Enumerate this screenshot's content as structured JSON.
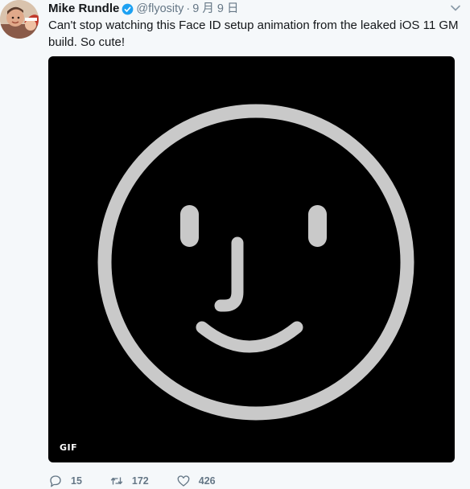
{
  "tweet": {
    "author_name": "Mike Rundle",
    "handle": "@flyosity",
    "separator": "·",
    "timestamp": "9 月 9 日",
    "text": "Can't stop watching this Face ID setup animation from the leaked iOS 11 GM build. So cute!",
    "media": {
      "badge": "GIF",
      "background": "#000000",
      "face_color": "#c9c9c9"
    },
    "actions": {
      "reply_count": "15",
      "retweet_count": "172",
      "like_count": "426"
    },
    "icons": {
      "verified": "verified-badge-icon",
      "caret": "chevron-down-icon",
      "reply": "reply-icon",
      "retweet": "retweet-icon",
      "like": "heart-icon"
    },
    "colors": {
      "verified": "#1da1f2",
      "muted": "#657786",
      "background": "#f5f8fa"
    }
  }
}
